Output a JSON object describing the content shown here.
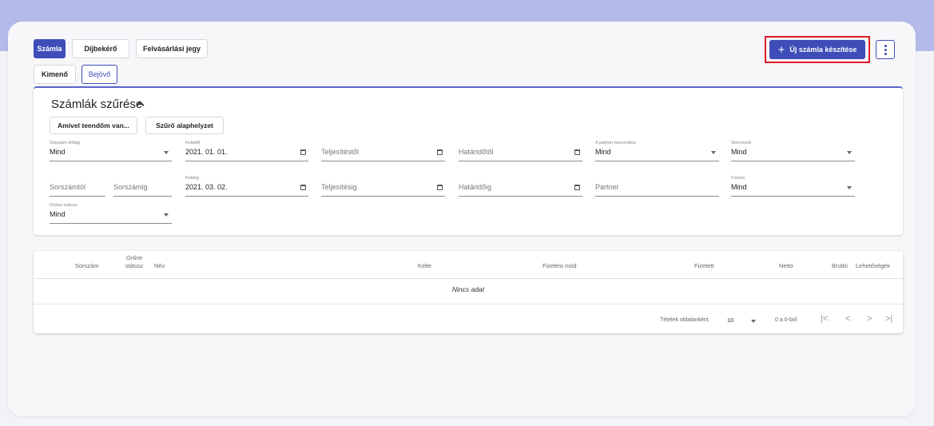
{
  "doc_tabs": [
    "Számla",
    "Díjbekérő",
    "Felvásárlási jegy"
  ],
  "direction_tabs": [
    "Kimenő",
    "Bejövő"
  ],
  "actions": {
    "new_invoice": "Új számla készítése",
    "new_invoice_icon": "plus-icon",
    "more_icon": "more-vertical-icon"
  },
  "filter": {
    "title": "Számlák szűrése",
    "buttons": [
      "Amivel teendőm van...",
      "Szűrő alaphelyzet"
    ],
    "prefix": {
      "label": "Sorszám előtag",
      "value": "Mind"
    },
    "issued_from": {
      "label": "Keltétől",
      "value": "2021. 01. 01."
    },
    "perf_from": {
      "placeholder": "Teljesítéstől"
    },
    "due_from": {
      "placeholder": "Határidőtől"
    },
    "partner_class": {
      "label": "A partner besorolása",
      "value": "Mind"
    },
    "cancelled": {
      "label": "Stornózott",
      "value": "Mind"
    },
    "serial_from": {
      "placeholder": "Sorszámtól"
    },
    "serial_to": {
      "placeholder": "Sorszámig"
    },
    "issued_to": {
      "label": "Keltéig",
      "value": "2021. 03. 02."
    },
    "perf_to": {
      "placeholder": "Teljesítésig"
    },
    "due_to": {
      "placeholder": "Határidőig"
    },
    "partner": {
      "placeholder": "Partner"
    },
    "paid": {
      "label": "Fizetve",
      "value": "Mind"
    },
    "online": {
      "label": "Online státusz",
      "value": "Mind"
    }
  },
  "table": {
    "headers": {
      "serial": "Sorszám",
      "online_l1": "Online",
      "online_l2": "státusz",
      "name": "Név",
      "issued": "Kelte",
      "pay_method": "Fizetési mód",
      "paid": "Fizetett",
      "net": "Nettó",
      "gross": "Bruttó",
      "options": "Lehetőségek"
    },
    "empty": "Nincs adat",
    "pager": {
      "label": "Tételek oldalanként",
      "per_page": "10",
      "range": "0 a 0-ból"
    }
  },
  "colors": {
    "primary": "#3f4db8",
    "highlight": "#e01b24",
    "band": "#b4bbe9"
  }
}
